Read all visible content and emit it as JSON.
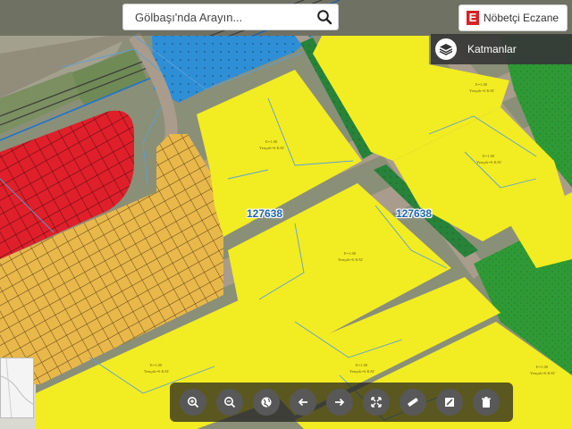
{
  "search": {
    "placeholder": "Gölbaşı'nda Arayın..."
  },
  "pharmacy": {
    "label": "Nöbetçi Eczane",
    "icon_letter": "E",
    "icon": "pharmacy-e-icon"
  },
  "layers": {
    "label": "Katmanlar",
    "icon": "layers-icon"
  },
  "parcels": [
    "127638",
    "127638"
  ],
  "toolbar": [
    {
      "name": "zoom-in",
      "icon": "zoom-in-icon"
    },
    {
      "name": "zoom-out",
      "icon": "zoom-out-icon"
    },
    {
      "name": "basemap",
      "icon": "globe-icon"
    },
    {
      "name": "back",
      "icon": "arrow-left-icon"
    },
    {
      "name": "forward",
      "icon": "arrow-right-icon"
    },
    {
      "name": "full-extent",
      "icon": "expand-icon"
    },
    {
      "name": "measure-distance",
      "icon": "ruler-icon"
    },
    {
      "name": "measure-area",
      "icon": "area-icon"
    },
    {
      "name": "clear",
      "icon": "trash-icon"
    }
  ],
  "colors": {
    "residential": "#f2ec22",
    "commercial": "#df1f2a",
    "public": "#2e8fd6",
    "green": "#2f9a35",
    "hatched": "#e8b84a",
    "road": "#a99c8c",
    "parcel_line": "#5aa0d8",
    "parcel_label": "#1f66b4",
    "toolbar_bg": "#2a2a2a"
  }
}
